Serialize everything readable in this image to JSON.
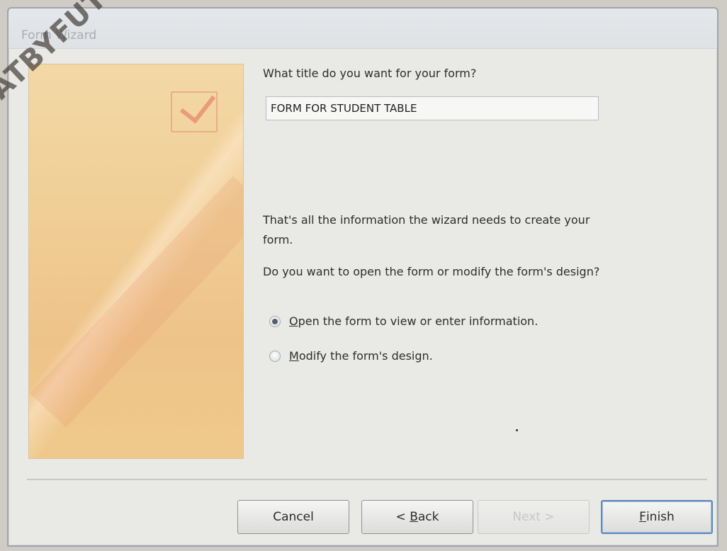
{
  "window": {
    "title": "Form Wizard"
  },
  "watermark": "DCATBYFUTUREDOCTOR",
  "main": {
    "title_question": "What title do you want for your form?",
    "title_value": "FORM FOR STUDENT TABLE",
    "info_line1": "That's all the information the wizard needs to create your",
    "info_line2": "form.",
    "open_or_modify_question": "Do you want to open the form or modify the form's design?",
    "options": [
      {
        "label_first": "O",
        "label_rest": "pen the form to view or enter information.",
        "selected": true
      },
      {
        "label_first": "M",
        "label_rest": "odify the form's design.",
        "selected": false
      }
    ]
  },
  "buttons": {
    "cancel": "Cancel",
    "back_prefix": "< ",
    "back_first": "B",
    "back_rest": "ack",
    "next": "Next >",
    "finish_first": "F",
    "finish_rest": "inish"
  },
  "colors": {
    "window_bg": "#e9e9e6",
    "side_panel": "#f0cf96",
    "default_button_border": "#5f89b9"
  },
  "icons": {
    "side_panel": "checkmark-form-icon",
    "option_radio": "radio-icon"
  }
}
